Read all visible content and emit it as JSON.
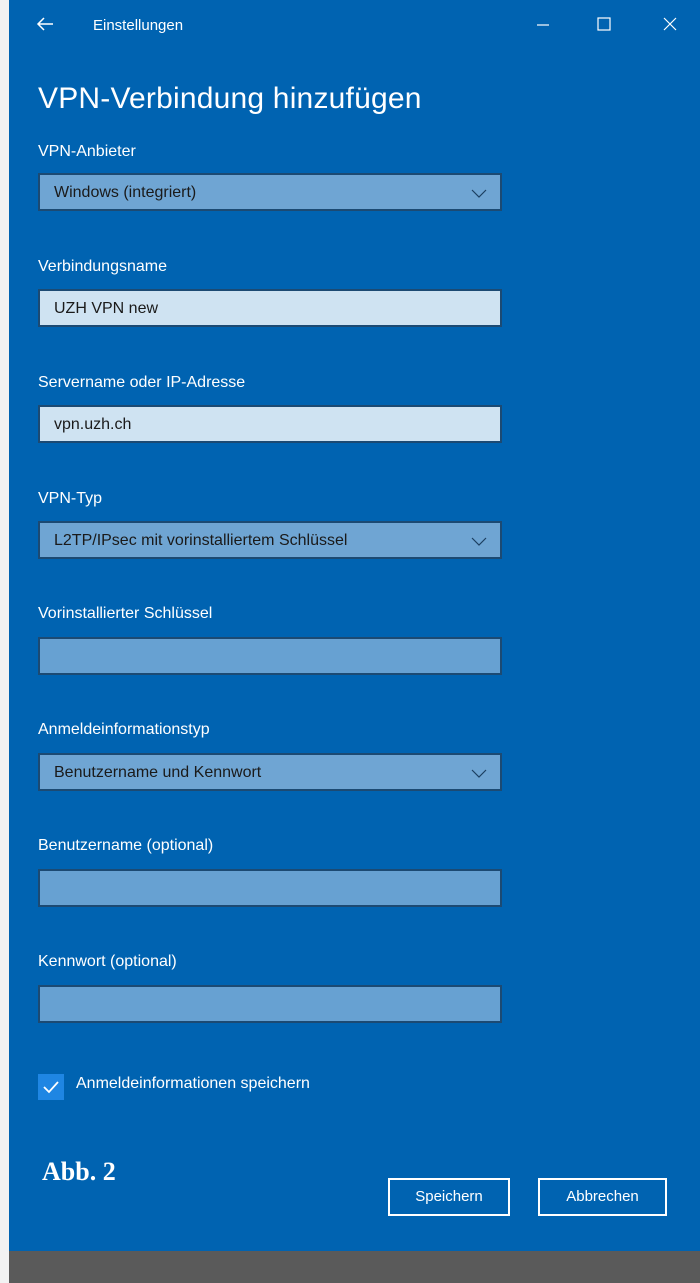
{
  "titlebar": {
    "title": "Einstellungen",
    "back_icon": "arrow-left-icon",
    "minimize_icon": "minimize-icon",
    "maximize_icon": "maximize-icon",
    "close_icon": "close-icon"
  },
  "page": {
    "heading": "VPN-Verbindung hinzufügen"
  },
  "form": {
    "provider": {
      "label": "VPN-Anbieter",
      "value": "Windows (integriert)"
    },
    "connection_name": {
      "label": "Verbindungsname",
      "value": "UZH VPN new"
    },
    "server": {
      "label": "Servername oder IP-Adresse",
      "value": "vpn.uzh.ch"
    },
    "vpn_type": {
      "label": "VPN-Typ",
      "value": "L2TP/IPsec mit vorinstalliertem Schlüssel"
    },
    "preshared_key": {
      "label": "Vorinstallierter Schlüssel",
      "value": ""
    },
    "signin_type": {
      "label": "Anmeldeinformationstyp",
      "value": "Benutzername und Kennwort"
    },
    "username": {
      "label": "Benutzername (optional)",
      "value": ""
    },
    "password": {
      "label": "Kennwort (optional)",
      "value": ""
    },
    "remember": {
      "label": "Anmeldeinformationen speichern",
      "checked": true
    }
  },
  "annotation": {
    "figure_label": "Abb. 2"
  },
  "buttons": {
    "save": "Speichern",
    "cancel": "Abbrechen"
  },
  "colors": {
    "accent": "#0063b1",
    "input_filled": "#cfe3f2",
    "input_empty": "#67a1d2",
    "checkbox": "#1f86e3"
  }
}
